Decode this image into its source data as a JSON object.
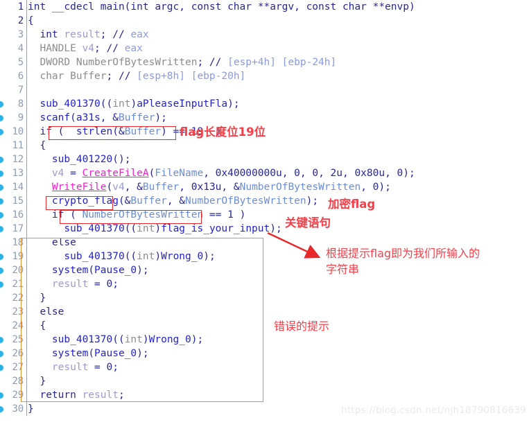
{
  "editor": {
    "lines": [
      {
        "num": "1",
        "breakpoint": false,
        "head": true,
        "html": "<span class='t-kw'>int __cdecl main(int argc, const char **argv, const char **envp)</span>"
      },
      {
        "num": "2",
        "breakpoint": false,
        "head": true,
        "html": "<span class='t-kw'>{</span>"
      },
      {
        "num": "3",
        "breakpoint": false,
        "head": false,
        "html": "  <span class='t-kw'>int </span><span class='t-var'>result</span><span class='t-kw'>; // </span><span class='t-cmt'>eax</span>"
      },
      {
        "num": "4",
        "breakpoint": false,
        "head": false,
        "html": "  <span class='t-type'>HANDLE </span><span class='t-var'>v4</span><span class='t-kw'>; // </span><span class='t-cmt'>eax</span>"
      },
      {
        "num": "5",
        "breakpoint": false,
        "head": false,
        "html": "  <span class='t-type'>DWORD NumberOfBytesWritten</span><span class='t-kw'>; // </span><span class='t-cmt'>[esp+4h] [ebp-24h]</span>"
      },
      {
        "num": "6",
        "breakpoint": false,
        "head": false,
        "html": "  <span class='t-type'>char Buffer</span><span class='t-kw'>; // </span><span class='t-cmt'>[esp+8h] [ebp-20h]</span>"
      },
      {
        "num": "7",
        "breakpoint": false,
        "head": false,
        "html": ""
      },
      {
        "num": "8",
        "breakpoint": true,
        "head": false,
        "html": "  <span class='t-fn'>sub_401370</span><span class='t-kw'>((</span><span class='t-type'>int</span><span class='t-kw'>)</span><span class='t-fn'>aPleaseInputFla</span><span class='t-kw'>);</span>"
      },
      {
        "num": "9",
        "breakpoint": true,
        "head": false,
        "html": "  <span class='t-fn'>scanf</span><span class='t-kw'>(</span><span class='t-fn'>a31s</span><span class='t-kw'>, &amp;</span><span class='t-glob'>Buffer</span><span class='t-kw'>);</span>"
      },
      {
        "num": "10",
        "breakpoint": true,
        "head": false,
        "html": "  <span class='t-kw'>if (  </span><span class='t-fn'>strlen</span><span class='t-kw'>(&amp;</span><span class='t-glob'>Buffer</span><span class='t-kw'>) == 19  )</span>"
      },
      {
        "num": "11",
        "breakpoint": false,
        "head": false,
        "html": "  <span class='t-kw'>{</span>"
      },
      {
        "num": "12",
        "breakpoint": true,
        "head": false,
        "html": "    <span class='t-fn'>sub_401220</span><span class='t-kw'>();</span>"
      },
      {
        "num": "13",
        "breakpoint": true,
        "head": false,
        "html": "    <span class='t-var'>v4</span><span class='t-kw'> = </span><span class='t-api'>CreateFileA</span><span class='t-kw'>(</span><span class='t-glob'>FileName</span><span class='t-kw'>, 0x40000000u, 0, 0, 2u, 0x80u, 0);</span>"
      },
      {
        "num": "14",
        "breakpoint": true,
        "head": false,
        "html": "    <span class='t-api'>WriteFile</span><span class='t-kw'>(</span><span class='t-var'>v4</span><span class='t-kw'>, &amp;</span><span class='t-glob'>Buffer</span><span class='t-kw'>, 0x13u, &amp;</span><span class='t-glob'>NumberOfBytesWritten</span><span class='t-kw'>, 0);</span>"
      },
      {
        "num": "15",
        "breakpoint": true,
        "head": false,
        "html": "    <span class='t-fn'>crypto_flag</span><span class='t-kw'>(&amp;</span><span class='t-glob'>Buffer</span><span class='t-kw'>, &amp;</span><span class='t-glob'>NumberOfBytesWritten</span><span class='t-kw'>);</span>"
      },
      {
        "num": "16",
        "breakpoint": true,
        "head": false,
        "html": "    <span class='t-kw'>if ( </span><span class='t-glob'>NumberOfBytesWritten</span><span class='t-kw'> == 1 )</span>"
      },
      {
        "num": "17",
        "breakpoint": true,
        "head": false,
        "html": "      <span class='t-fn'>sub_401370</span><span class='t-kw'>((</span><span class='t-type'>int</span><span class='t-kw'>)</span><span class='t-fn'>flag_is_your_input</span><span class='t-kw'>);</span>"
      },
      {
        "num": "18",
        "breakpoint": false,
        "head": false,
        "html": "    <span class='t-kw'>else</span>"
      },
      {
        "num": "19",
        "breakpoint": true,
        "head": false,
        "html": "      <span class='t-fn'>sub_401370</span><span class='t-kw'>((</span><span class='t-type'>int</span><span class='t-kw'>)</span><span class='t-fn'>Wrong_0</span><span class='t-kw'>);</span>"
      },
      {
        "num": "20",
        "breakpoint": true,
        "head": false,
        "html": "    <span class='t-fn'>system</span><span class='t-kw'>(</span><span class='t-fn'>Pause_0</span><span class='t-kw'>);</span>"
      },
      {
        "num": "21",
        "breakpoint": true,
        "head": false,
        "html": "    <span class='t-var'>result</span><span class='t-kw'> = 0;</span>"
      },
      {
        "num": "22",
        "breakpoint": false,
        "head": false,
        "html": "  <span class='t-kw'>}</span>"
      },
      {
        "num": "23",
        "breakpoint": false,
        "head": false,
        "html": "  <span class='t-kw'>else</span>"
      },
      {
        "num": "24",
        "breakpoint": false,
        "head": false,
        "html": "  <span class='t-kw'>{</span>"
      },
      {
        "num": "25",
        "breakpoint": true,
        "head": false,
        "html": "    <span class='t-fn'>sub_401370</span><span class='t-kw'>((</span><span class='t-type'>int</span><span class='t-kw'>)</span><span class='t-fn'>Wrong_0</span><span class='t-kw'>);</span>"
      },
      {
        "num": "26",
        "breakpoint": true,
        "head": false,
        "html": "    <span class='t-fn'>system</span><span class='t-kw'>(</span><span class='t-fn'>Pause_0</span><span class='t-kw'>);</span>"
      },
      {
        "num": "27",
        "breakpoint": true,
        "head": false,
        "html": "    <span class='t-var'>result</span><span class='t-kw'> = 0;</span>"
      },
      {
        "num": "28",
        "breakpoint": false,
        "head": false,
        "html": "  <span class='t-kw'>}</span>"
      },
      {
        "num": "29",
        "breakpoint": true,
        "head": false,
        "html": "  <span class='t-kw'>return </span><span class='t-var'>result</span><span class='t-kw'>;</span>"
      },
      {
        "num": "30",
        "breakpoint": true,
        "head": false,
        "html": "<span class='t-kw'>}</span>"
      }
    ],
    "plain_lines": [
      "int __cdecl main(int argc, const char **argv, const char **envp)",
      "{",
      "  int result; // eax",
      "  HANDLE v4; // eax",
      "  DWORD NumberOfBytesWritten; // [esp+4h] [ebp-24h]",
      "  char Buffer; // [esp+8h] [ebp-20h]",
      "",
      "  sub_401370((int)aPleaseInputFla);",
      "  scanf(a31s, &Buffer);",
      "  if ( strlen(&Buffer) == 19 )",
      "  {",
      "    sub_401220();",
      "    v4 = CreateFileA(FileName, 0x40000000u, 0, 0, 2u, 0x80u, 0);",
      "    WriteFile(v4, &Buffer, 0x13u, &NumberOfBytesWritten, 0);",
      "    crypto_flag(&Buffer, &NumberOfBytesWritten);",
      "    if ( NumberOfBytesWritten == 1 )",
      "      sub_401370((int)flag_is_your_input);",
      "    else",
      "      sub_401370((int)Wrong_0);",
      "    system(Pause_0);",
      "    result = 0;",
      "  }",
      "  else",
      "  {",
      "    sub_401370((int)Wrong_0);",
      "    system(Pause_0);",
      "    result = 0;",
      "  }",
      "  return result;",
      "}"
    ]
  },
  "highlights": {
    "strlen_box_label": "strlen(&Buffer) == 19",
    "crypto_flag_box_label": "crypto_flag",
    "bytes_written_box_label": "NumberOfBytesWritten == 1",
    "else_block_box_label": "else-branch-block",
    "red_color": "#e8282a",
    "orange_color": "#e8922a",
    "breakpoint_color": "#2bb3e8"
  },
  "annotations": {
    "flag_length": "flag长度位19位",
    "encrypt_flag": "加密flag",
    "key_statement": "关键语句",
    "flag_is_input": "根据提示flag即为我们所输入的\n字符串",
    "wrong_hint": "错误的提示",
    "note_color": "#f5404a"
  },
  "watermark": {
    "text": "https://blog.csdn.net/njh18790816639"
  }
}
